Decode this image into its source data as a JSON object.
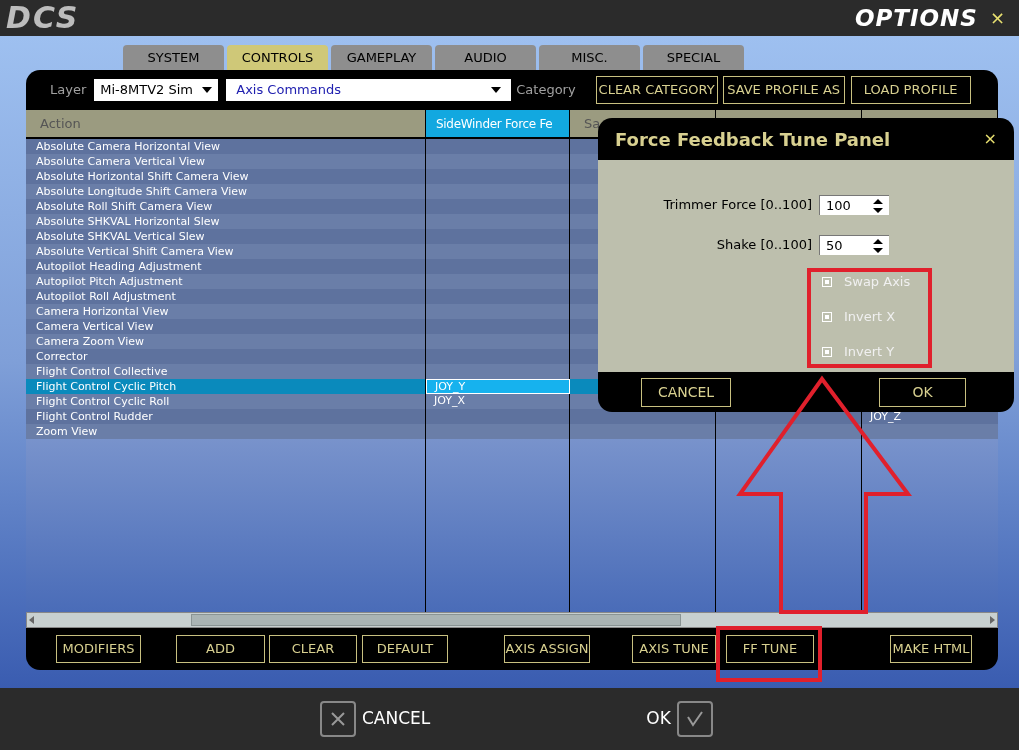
{
  "window": {
    "logo": "DCS",
    "title": "OPTIONS",
    "close": "×"
  },
  "tabs": [
    {
      "label": "SYSTEM",
      "selected": false
    },
    {
      "label": "CONTROLS",
      "selected": true
    },
    {
      "label": "GAMEPLAY",
      "selected": false
    },
    {
      "label": "AUDIO",
      "selected": false
    },
    {
      "label": "MISC.",
      "selected": false
    },
    {
      "label": "SPECIAL",
      "selected": false
    }
  ],
  "toolbar": {
    "layer_label": "Layer",
    "layer_value": "Mi-8MTV2 Sim",
    "category_value": "Axis Commands",
    "category_label": "Category",
    "buttons": [
      "CLEAR CATEGORY",
      "SAVE PROFILE AS",
      "LOAD PROFILE"
    ]
  },
  "table": {
    "columns": [
      {
        "label": "Action",
        "selected": false
      },
      {
        "label": "SideWinder Force Fe",
        "selected": true
      },
      {
        "label": "Sa",
        "selected": false
      }
    ],
    "rows": [
      {
        "action": "Absolute Camera Horizontal View",
        "selected": false
      },
      {
        "action": "Absolute Camera Vertical View",
        "selected": false
      },
      {
        "action": "Absolute Horizontal Shift Camera View",
        "selected": false
      },
      {
        "action": "Absolute Longitude Shift Camera View",
        "selected": false
      },
      {
        "action": "Absolute Roll Shift Camera View",
        "selected": false
      },
      {
        "action": "Absolute SHKVAL Horizontal Slew",
        "selected": false
      },
      {
        "action": "Absolute SHKVAL Vertical Slew",
        "selected": false
      },
      {
        "action": "Absolute Vertical Shift Camera View",
        "selected": false
      },
      {
        "action": "Autopilot Heading Adjustment",
        "selected": false
      },
      {
        "action": "Autopilot Pitch Adjustment",
        "selected": false
      },
      {
        "action": "Autopilot Roll Adjustment",
        "selected": false
      },
      {
        "action": "Camera Horizontal View",
        "selected": false
      },
      {
        "action": "Camera Vertical View",
        "selected": false
      },
      {
        "action": "Camera Zoom View",
        "selected": false
      },
      {
        "action": "Corrector",
        "selected": false
      },
      {
        "action": "Flight Control Collective",
        "selected": false
      },
      {
        "action": "Flight Control Cyclic Pitch",
        "selected": true,
        "sidewinder": "JOY_Y"
      },
      {
        "action": "Flight Control Cyclic Roll",
        "selected": false,
        "sidewinder": "JOY_X"
      },
      {
        "action": "Flight Control Rudder",
        "selected": false,
        "column_5": "JOY_Z"
      },
      {
        "action": "Zoom View",
        "selected": false
      }
    ]
  },
  "bottom_buttons": [
    "MODIFIERS",
    "ADD",
    "CLEAR",
    "DEFAULT",
    "AXIS ASSIGN",
    "AXIS TUNE",
    "FF TUNE",
    "MAKE HTML"
  ],
  "ff_dialog": {
    "title": "Force Feedback Tune Panel",
    "close": "×",
    "spinners": [
      {
        "label": "Trimmer Force [0..100]",
        "value": "100"
      },
      {
        "label": "Shake [0..100]",
        "value": "50"
      }
    ],
    "checkboxes": [
      {
        "label": "Swap Axis",
        "checked": true,
        "disabled": true
      },
      {
        "label": "Invert X",
        "checked": true,
        "disabled": true
      },
      {
        "label": "Invert Y",
        "checked": true,
        "disabled": true
      }
    ],
    "buttons": [
      "CANCEL",
      "OK"
    ]
  },
  "footer": {
    "cancel": "CANCEL",
    "ok": "OK"
  }
}
